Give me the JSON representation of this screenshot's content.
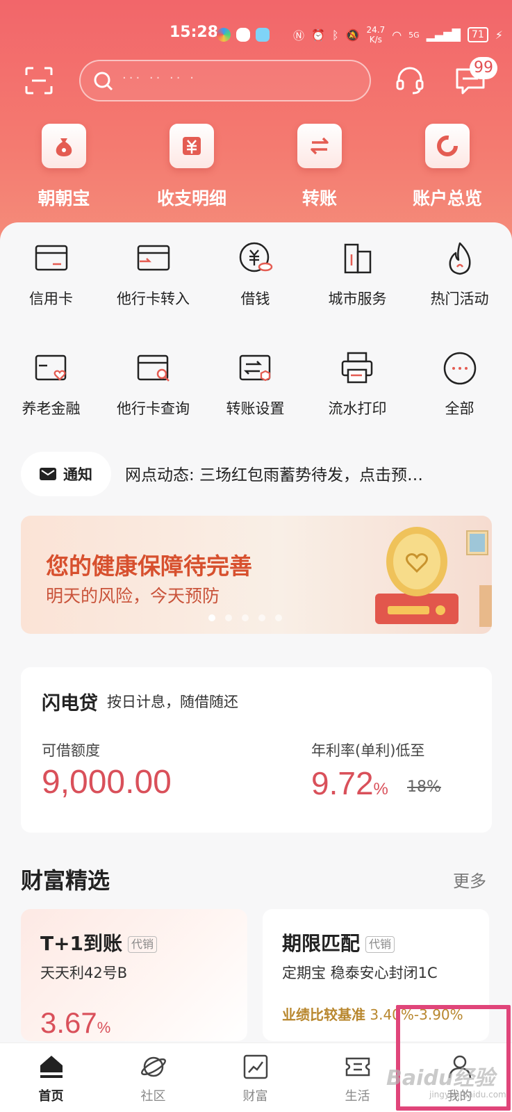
{
  "status_bar": {
    "time": "15:28",
    "net_speed_value": "24.7",
    "net_speed_unit": "K/s",
    "battery": "71",
    "signal": "5G"
  },
  "top_bar": {
    "search_placeholder": "··· ·· ·· ·",
    "message_badge": "99"
  },
  "quick_actions": [
    {
      "label": "朝朝宝",
      "icon": "money-bag-icon"
    },
    {
      "label": "收支明细",
      "icon": "yuan-icon"
    },
    {
      "label": "转账",
      "icon": "transfer-arrows-icon"
    },
    {
      "label": "账户总览",
      "icon": "pie-ring-icon"
    }
  ],
  "services": [
    {
      "label": "信用卡",
      "icon": "credit-card-icon"
    },
    {
      "label": "他行卡转入",
      "icon": "card-transfer-in-icon"
    },
    {
      "label": "借钱",
      "icon": "yuan-coin-icon"
    },
    {
      "label": "城市服务",
      "icon": "city-building-icon"
    },
    {
      "label": "热门活动",
      "icon": "flame-icon"
    },
    {
      "label": "养老金融",
      "icon": "pension-card-icon"
    },
    {
      "label": "他行卡查询",
      "icon": "card-search-icon"
    },
    {
      "label": "转账设置",
      "icon": "transfer-settings-icon"
    },
    {
      "label": "流水打印",
      "icon": "printer-icon"
    },
    {
      "label": "全部",
      "icon": "more-dots-icon"
    }
  ],
  "notice": {
    "label": "通知",
    "text": "网点动态: 三场红包雨蓄势待发，点击预…"
  },
  "banner": {
    "title": "您的健康保障待完善",
    "subtitle": "明天的风险，今天预防",
    "active_index": 0,
    "dot_count": 5
  },
  "loan": {
    "name": "闪电贷",
    "desc": "按日计息，随借随还",
    "limit_label": "可借额度",
    "limit_value": "9,000.00",
    "rate_label": "年利率(单利)低至",
    "rate_value": "9.72",
    "rate_unit": "%",
    "rate_old": "18%"
  },
  "wealth": {
    "title": "财富精选",
    "more": "更多",
    "products": [
      {
        "title": "T+1到账",
        "tag": "代销",
        "name": "天天利42号B",
        "rate": "3.67",
        "rate_unit": "%"
      },
      {
        "title": "期限匹配",
        "tag": "代销",
        "name": "定期宝  稳泰安心封闭1C",
        "bench_label": "业绩比较基准",
        "bench_value": "3.40%-3.90%"
      }
    ]
  },
  "tabs": [
    {
      "label": "首页",
      "active": true
    },
    {
      "label": "社区",
      "active": false
    },
    {
      "label": "财富",
      "active": false
    },
    {
      "label": "生活",
      "active": false
    },
    {
      "label": "我的",
      "active": false
    }
  ],
  "watermark": {
    "text": "Baidu经验",
    "sub": "jingyan.baidu.com"
  },
  "colors": {
    "brand_red": "#f2666a",
    "value_red": "#d9505a",
    "highlight": "#e0457a"
  }
}
